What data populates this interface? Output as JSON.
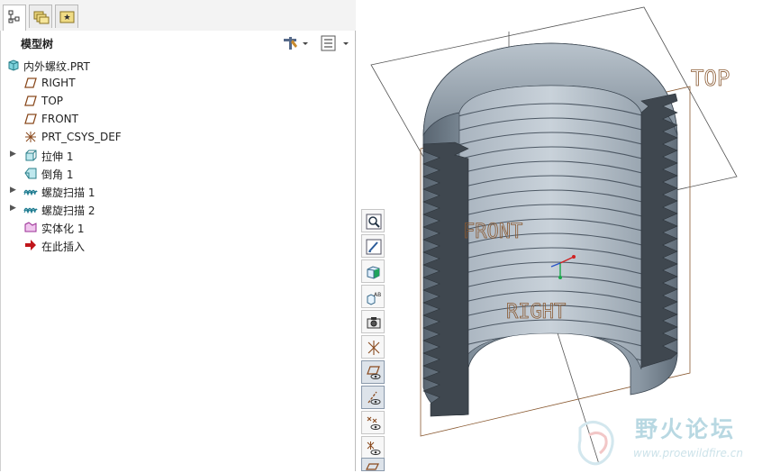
{
  "panel": {
    "title": "模型树"
  },
  "tree": [
    {
      "label": "内外螺纹.PRT",
      "icon": "part-icon",
      "expandable": false
    },
    {
      "label": "RIGHT",
      "icon": "datum-plane-icon",
      "expandable": false
    },
    {
      "label": "TOP",
      "icon": "datum-plane-icon",
      "expandable": false
    },
    {
      "label": "FRONT",
      "icon": "datum-plane-icon",
      "expandable": false
    },
    {
      "label": "PRT_CSYS_DEF",
      "icon": "coordinate-system-icon",
      "expandable": false
    },
    {
      "label": "拉伸 1",
      "icon": "extrude-icon",
      "expandable": true
    },
    {
      "label": "倒角 1",
      "icon": "chamfer-icon",
      "expandable": false
    },
    {
      "label": "螺旋扫描 1",
      "icon": "helical-sweep-icon",
      "expandable": true
    },
    {
      "label": "螺旋扫描 2",
      "icon": "helical-sweep-icon",
      "expandable": true
    },
    {
      "label": "实体化 1",
      "icon": "solidify-icon",
      "expandable": false
    },
    {
      "label": "在此插入",
      "icon": "insert-here-arrow-icon",
      "expandable": false
    }
  ],
  "viewport": {
    "plane_labels": {
      "top": "TOP",
      "front": "FRONT",
      "right": "RIGHT"
    }
  },
  "watermark": {
    "name": "野火论坛",
    "url": "www.proewildfire.cn"
  }
}
